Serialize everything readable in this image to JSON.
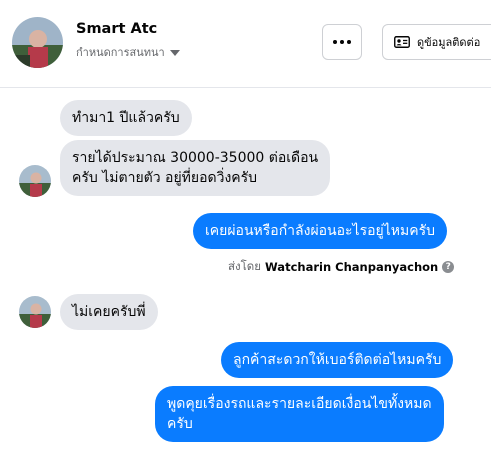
{
  "header": {
    "contact_name": "Smart Atc",
    "subtitle": "กำหนดการสนทนา",
    "more_label": "···",
    "info_label": "ดูข้อมูลติดต่อ"
  },
  "messages": [
    {
      "side": "incoming",
      "text": "ทำมา1 ปีแล้วครับ"
    },
    {
      "side": "incoming",
      "lines": [
        "รายได้ประมาณ 30000-35000 ต่อเดือน",
        "ครับ ไม่ตายตัว อยู่ที่ยอดวิ่งครับ"
      ]
    },
    {
      "side": "outgoing",
      "text": "เคยผ่อนหรือกำลังผ่อนอะไรอยู่ไหมครับ"
    },
    {
      "side": "incoming",
      "text": "ไม่เคยครับพี่"
    },
    {
      "side": "outgoing",
      "text": "ลูกค้าสะดวกให้เบอร์ติดต่อไหมครับ"
    },
    {
      "side": "outgoing",
      "lines": [
        "พูดคุยเรื่องรถและรายละเอียดเงื่อนไขทั้งหมด",
        "ครับ"
      ]
    }
  ],
  "sent_by": {
    "prefix": "ส่งโดย",
    "sender": "Watcharin Chanpanyachon",
    "icon": "help-icon"
  },
  "colors": {
    "outgoing_bubble": "#0a7cff",
    "incoming_bubble": "#e4e6eb"
  }
}
